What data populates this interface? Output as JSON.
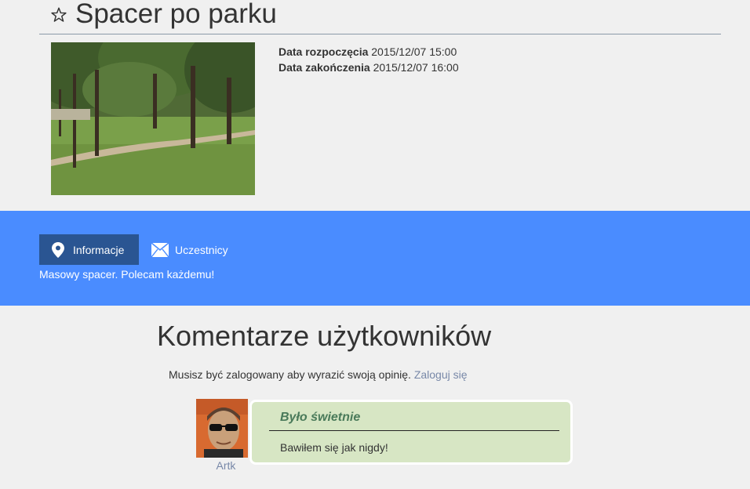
{
  "event": {
    "title": "Spacer po parku",
    "start_label": "Data rozpoczęcia",
    "start_value": "2015/12/07 15:00",
    "end_label": "Data zakończenia",
    "end_value": "2015/12/07 16:00"
  },
  "tabs": {
    "info_label": "Informacje",
    "participants_label": "Uczestnicy"
  },
  "description": "Masowy spacer. Polecam każdemu!",
  "comments": {
    "heading": "Komentarze użytkowników",
    "login_note": "Musisz być zalogowany aby wyrazić swoją opinię.",
    "login_link": "Zaloguj się",
    "items": [
      {
        "author": "Artk",
        "title": "Było świetnie",
        "text": "Bawiłem się jak nigdy!"
      }
    ]
  },
  "icons": {
    "title": "star-outline-icon",
    "info_tab": "map-pin-icon",
    "participants_tab": "envelope-icon"
  },
  "colors": {
    "band": "#4a8cff",
    "active_tab": "#2a5592",
    "comment_bg": "#d7e6c4",
    "comment_title": "#4a7a5a",
    "link": "#7888a8"
  }
}
